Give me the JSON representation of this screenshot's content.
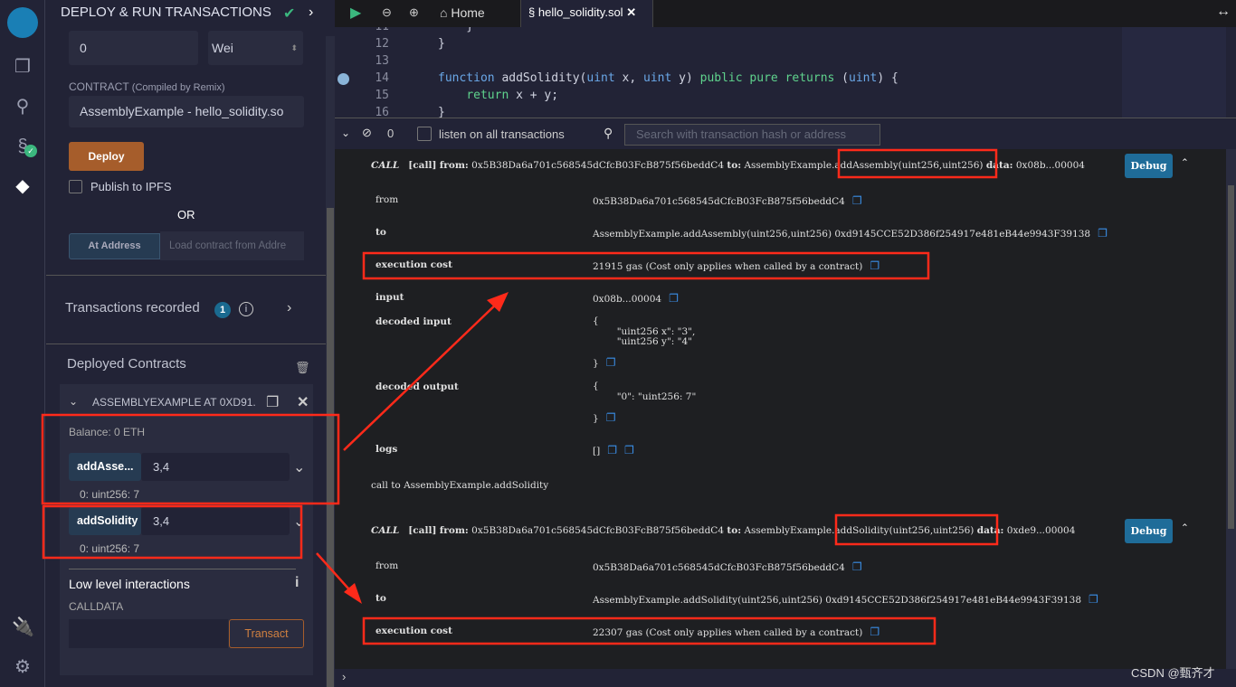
{
  "sidebar_panel": {
    "title": "DEPLOY & RUN TRANSACTIONS",
    "value": "0",
    "unit": "Wei",
    "contract_label": "CONTRACT",
    "contract_sublabel": "(Compiled by Remix)",
    "contract": "AssemblyExample - hello_solidity.so",
    "deploy": "Deploy",
    "publish": "Publish to IPFS",
    "or": "OR",
    "at_address": "At Address",
    "at_address_placeholder": "Load contract from Addre",
    "tx_recorded": "Transactions recorded",
    "tx_count": "1",
    "deployed": "Deployed Contracts",
    "instance": "ASSEMBLYEXAMPLE AT 0XD91.",
    "balance": "Balance: 0 ETH",
    "functions": [
      {
        "name": "addAsse...",
        "arg": "3,4",
        "output": "0: uint256: 7"
      },
      {
        "name": "addSolidity",
        "arg": "3,4",
        "output": "0: uint256: 7"
      }
    ],
    "low_level": "Low level interactions",
    "calldata": "CALLDATA",
    "transact": "Transact"
  },
  "tabs": {
    "home": "Home",
    "file": "hello_solidity.sol"
  },
  "editor": {
    "lines": [
      {
        "n": "11",
        "code": "    }"
      },
      {
        "n": "12",
        "code": "}"
      },
      {
        "n": "13",
        "code": ""
      },
      {
        "n": "14",
        "code": "function addSolidity(uint x, uint y) public pure returns (uint) {"
      },
      {
        "n": "15",
        "code": "    return x + y;"
      },
      {
        "n": "16",
        "code": "}"
      }
    ]
  },
  "terminal_bar": {
    "count": "0",
    "listen": "listen on all transactions",
    "search_placeholder": "Search with transaction hash or address"
  },
  "tx1": {
    "call": "CALL",
    "tag": "[call]",
    "from_label": "from:",
    "from": "0x5B38Da6a701c568545dCfcB03FcB875f56beddC4",
    "to_label": "to:",
    "to_contract": "AssemblyExample.",
    "method": "addAssembly(uint256,uint256)",
    "data_label": "data:",
    "data": "0x08b...00004",
    "debug": "Debug",
    "rows": {
      "from_k": "from",
      "from_v": "0x5B38Da6a701c568545dCfcB03FcB875f56beddC4",
      "to_k": "to",
      "to_v": "AssemblyExample.addAssembly(uint256,uint256) 0xd9145CCE52D386f254917e481eB44e9943F39138",
      "cost_k": "execution cost",
      "cost_v": "21915 gas (Cost only applies when called by a contract)",
      "input_k": "input",
      "input_v": "0x08b...00004",
      "din_k": "decoded input",
      "din_v": "{\n        \"uint256 x\": \"3\",\n        \"uint256 y\": \"4\"\n\n}",
      "dout_k": "decoded output",
      "dout_v": "{\n        \"0\": \"uint256: 7\"\n\n}",
      "logs_k": "logs",
      "logs_v": "[]"
    }
  },
  "call_note": "call to AssemblyExample.addSolidity",
  "tx2": {
    "call": "CALL",
    "tag": "[call]",
    "from_label": "from:",
    "from": "0x5B38Da6a701c568545dCfcB03FcB875f56beddC4",
    "to_label": "to:",
    "to_contract": "AssemblyExample.",
    "method": "addSolidity(uint256,uint256)",
    "data_label": "data:",
    "data": "0xde9...00004",
    "debug": "Debug",
    "rows": {
      "from_k": "from",
      "from_v": "0x5B38Da6a701c568545dCfcB03FcB875f56beddC4",
      "to_k": "to",
      "to_v": "AssemblyExample.addSolidity(uint256,uint256) 0xd9145CCE52D386f254917e481eB44e9943F39138",
      "cost_k": "execution cost",
      "cost_v": "22307 gas (Cost only applies when called by a contract)"
    }
  },
  "watermark": "CSDN @甄齐才",
  "colors": {
    "accent": "#a65d2b",
    "debug": "#1f6c99",
    "annotation": "#ff2a1a"
  }
}
